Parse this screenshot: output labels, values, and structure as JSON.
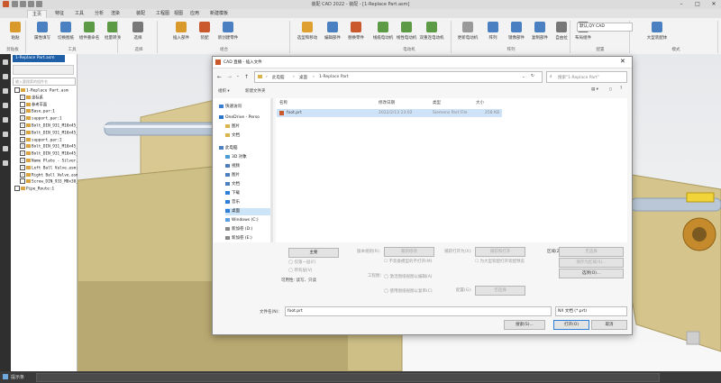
{
  "window": {
    "title": "装配 CAD 2022 - 装配 - [1-Replace Part.asm]",
    "minimize": "–",
    "maximize": "□",
    "close": "✕"
  },
  "menus": [
    "主页",
    "特征",
    "工具",
    "分析",
    "渲染",
    "装配",
    "工程图",
    "视图",
    "应用",
    "新建模板"
  ],
  "active_menu_index": 0,
  "ribbon": {
    "buttons": [
      {
        "label": "粘贴",
        "color": "#d99a2b"
      },
      {
        "label": "属性填写",
        "color": "#4a7fc1"
      },
      {
        "label": "切换图纸",
        "color": "#4a7fc1"
      },
      {
        "label": "组件重命名",
        "color": "#5d9a45"
      },
      {
        "label": "批量转换",
        "color": "#5d9a45"
      },
      {
        "label": "选择",
        "color": "#777777"
      },
      {
        "label": "插入部件",
        "color": "#d99a2b"
      },
      {
        "label": "装配",
        "color": "#c9582d"
      },
      {
        "label": "新创建零件",
        "color": "#4a7fc1"
      },
      {
        "label": "选型和移动",
        "color": "#e0a030"
      },
      {
        "label": "编辑部件",
        "color": "#4a7fc1"
      },
      {
        "label": "替换零件",
        "color": "#c9582d"
      },
      {
        "label": "线缆电动机",
        "color": "#5d9a45"
      },
      {
        "label": "线性电动机",
        "color": "#5d9a45"
      },
      {
        "label": "双重连电动机",
        "color": "#5d9a45"
      },
      {
        "label": "更新电动机",
        "color": "#999999"
      },
      {
        "label": "阵列",
        "color": "#4a7fc1"
      },
      {
        "label": "镜像部件",
        "color": "#4a7fc1"
      },
      {
        "label": "复制部件",
        "color": "#4a7fc1"
      },
      {
        "label": "自由拉",
        "color": "#777777"
      },
      {
        "label": "布局组件",
        "color": "#777777"
      },
      {
        "label": "大型装配体",
        "color": "#4a7fc1"
      }
    ],
    "groups": [
      {
        "label": "剪贴板"
      },
      {
        "label": "工具"
      },
      {
        "label": "选择"
      },
      {
        "label": "组合"
      },
      {
        "label": "电动机"
      },
      {
        "label": "阵列"
      },
      {
        "label": "配置"
      },
      {
        "label": "模式"
      }
    ],
    "config_dropdown": "默认,QY CAD"
  },
  "navigator": {
    "tab": "1-Replace Part.asm",
    "search_placeholder": "输入要搜索的组件名",
    "items": [
      {
        "text": "1-Replace Part.asm",
        "indent": 0,
        "check": ""
      },
      {
        "text": "坐标系",
        "indent": 1,
        "check": "✓"
      },
      {
        "text": "参考平面",
        "indent": 1,
        "check": ""
      },
      {
        "text": "Base.par:1",
        "indent": 1,
        "check": "✓"
      },
      {
        "text": "support.par:1",
        "indent": 1,
        "check": "✓"
      },
      {
        "text": "Bolt_DIN_931_M10x45_v10.00.p",
        "indent": 1,
        "check": "✓"
      },
      {
        "text": "Bolt_DIN_931_M10x45_v10.00.p",
        "indent": 1,
        "check": "✓"
      },
      {
        "text": "support.par:2",
        "indent": 1,
        "check": "✓"
      },
      {
        "text": "Bolt_DIN_931_M10x45_v10.00.p",
        "indent": 1,
        "check": "✓"
      },
      {
        "text": "Bolt_DIN_931_M10x45_v10.00.p",
        "indent": 1,
        "check": "✓"
      },
      {
        "text": "Name Plate - Silver.par:1",
        "indent": 1,
        "check": "✓"
      },
      {
        "text": "Left Ball Valve.asm:1",
        "indent": 1,
        "check": "✓"
      },
      {
        "text": "Right Ball Valve.asm:1",
        "indent": 1,
        "check": "✓"
      },
      {
        "text": "Screw_DIN_933_M8x30_v10.00.p",
        "indent": 1,
        "check": ""
      },
      {
        "text": "Pipe_Route:1",
        "indent": 0,
        "check": ""
      }
    ]
  },
  "status": {
    "label": "提示条"
  },
  "dialog": {
    "title": "CAD 直播 - 插入文件",
    "breadcrumb": [
      "此电脑",
      "桌面",
      "1-Replace Part"
    ],
    "search_placeholder": "搜索\"1-Replace Part\"",
    "organize": "组织 ▾",
    "new_folder": "新建文件夹",
    "sidebar": [
      {
        "label": "快速访问",
        "color": "#3c7fd2"
      },
      {
        "label": "OneDrive - Perso",
        "color": "#2a75c9"
      },
      {
        "label": "图片",
        "color": "#d9b34b"
      },
      {
        "label": "文档",
        "color": "#d9b34b"
      },
      {
        "label": "此电脑",
        "color": "#4d7fbf"
      },
      {
        "label": "3D 对象",
        "color": "#4d9bd3"
      },
      {
        "label": "视频",
        "color": "#4d7fbf"
      },
      {
        "label": "图片",
        "color": "#4d7fbf"
      },
      {
        "label": "文档",
        "color": "#4d7fbf"
      },
      {
        "label": "下载",
        "color": "#2f7ed8"
      },
      {
        "label": "音乐",
        "color": "#2f7ed8"
      },
      {
        "label": "桌面",
        "color": "#2f7ed8"
      },
      {
        "label": "Windows (C:)",
        "color": "#5aa0e0"
      },
      {
        "label": "新加卷 (D:)",
        "color": "#888888"
      },
      {
        "label": "新加卷 (E:)",
        "color": "#888888"
      }
    ],
    "selected_sidebar_index": 11,
    "columns": [
      "名称",
      "修改日期",
      "类型",
      "大小"
    ],
    "files": [
      {
        "name": "foot.prt",
        "date": "2022/2/13 23:02",
        "type": "Siemens Part File",
        "size": "258 KB"
      }
    ],
    "lower": {
      "main_btn": "主要",
      "only_first": "仅第一层(F)",
      "all_levels": "所有层(V)",
      "usable": "可用性: 读写、只读",
      "version_rule": "版本规则(R):",
      "version_value": "最新修改",
      "no_load_label": "不装备模型的不打开(M)",
      "workfile_label": "工程图:",
      "ws_opt1": "激活图纸视图以编辑(A)",
      "ws_opt2": "使用图纸视图以复审(C)",
      "related_label": "捕获打开为(X):",
      "related_value": "捕获和打开",
      "large_view": "为大型装配打开装配预览",
      "config_label": "配置(G):",
      "config_value": "无选择",
      "zone_label": "区域(Z):",
      "zone_value": "无选择",
      "save_btn": "保存为区域(S)...",
      "options_btn": "选项(O)..."
    },
    "filename_label": "文件名(N):",
    "filename_value": "foot.prt",
    "filetype_value": "NX 文档 (*.prt)",
    "search_btn": "搜索(S)...",
    "open_btn": "打开(O)",
    "cancel_btn": "取消"
  }
}
